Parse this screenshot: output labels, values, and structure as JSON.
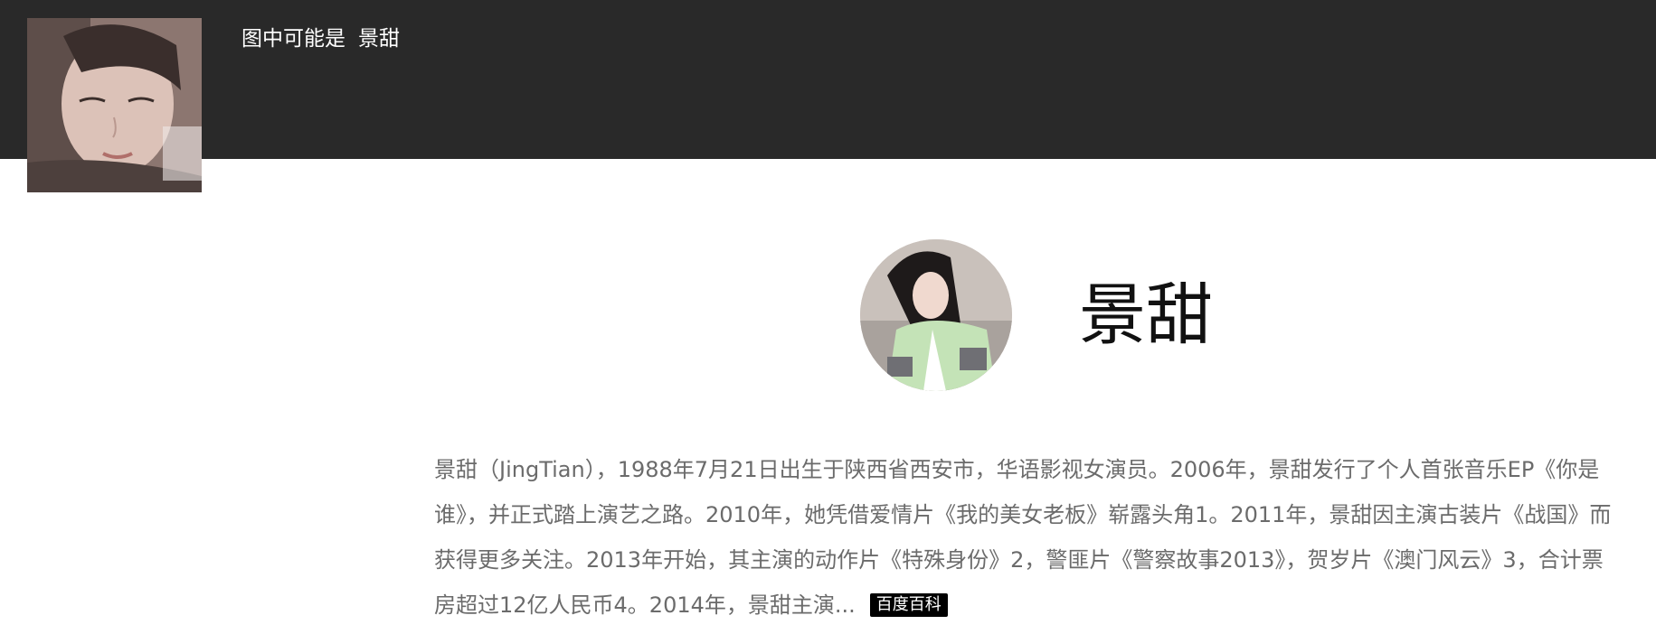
{
  "header": {
    "caption_prefix": "图中可能是",
    "caption_name": "景甜"
  },
  "entity": {
    "title": "景甜",
    "bio": "景甜（JingTian），1988年7月21日出生于陕西省西安市，华语影视女演员。2006年，景甜发行了个人首张音乐EP《你是谁》，并正式踏上演艺之路。2010年，她凭借爱情片《我的美女老板》崭露头角1。2011年，景甜因主演古装片《战国》而获得更多关注。2013年开始，其主演的动作片《特殊身份》2，警匪片《警察故事2013》，贺岁片《澳门风云》3，合计票房超过12亿人民币4。2014年，景甜主演...",
    "source_badge": "百度百科"
  },
  "colors": {
    "header_bg": "#292929",
    "bio_text": "#6b6b6b",
    "badge_bg": "#000000"
  }
}
